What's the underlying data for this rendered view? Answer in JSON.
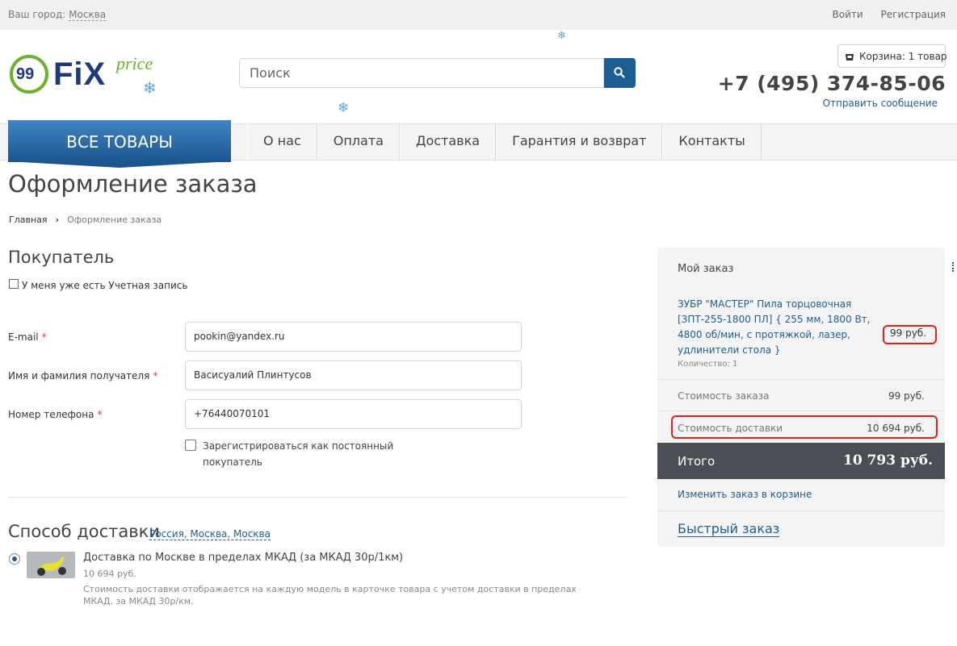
{
  "topbar": {
    "city_label": "Ваш город:",
    "city_value": "Москва",
    "login": "Войти",
    "register": "Регистрация"
  },
  "logo": {
    "badge": "99",
    "brand": "FiX",
    "brand_sub": "price"
  },
  "search": {
    "placeholder": "Поиск"
  },
  "header": {
    "cart": "Корзина: 1 товар",
    "phone": "+7 (495) 374-85-06",
    "send_message": "Отправить сообщение"
  },
  "nav": {
    "all_goods": "ВСЕ ТОВАРЫ",
    "items": [
      "О нас",
      "Оплата",
      "Доставка",
      "Гарантия и возврат",
      "Контакты"
    ]
  },
  "page": {
    "title": "Оформление заказа",
    "breadcrumb": [
      "Главная",
      "Оформление заказа"
    ]
  },
  "buyer": {
    "heading": "Покупатель",
    "have_account": "У меня уже есть Учетная запись",
    "email_label": "E-mail",
    "email_value": "pookin@yandex.ru",
    "name_label": "Имя и фамилия получателя",
    "name_value": "Васисуалий Плинтусов",
    "phone_label": "Номер телефона",
    "phone_value": "+76440070101",
    "register_label": "Зарегистрироваться как постоянный покупатель",
    "required_mark": "*"
  },
  "delivery": {
    "heading": "Способ доставки",
    "location": "Россия, Москва, Москва",
    "option_title": "Доставка по Москве в пределах МКАД (за МКАД 30р/1км)",
    "option_price": "10 694 руб.",
    "option_desc": "Стоимость доставки отображается на каждую модель в карточке товара с учетом доставки в пределах МКАД, за МКАД 30р/км."
  },
  "order": {
    "heading": "Мой заказ",
    "item_name": "ЗУБР \"МАСТЕР\" Пила торцовочная [ЗПТ-255-1800 ПЛ] { 255 мм, 1800 Вт, 4800 об/мин, с протяжкой, лазер, удлинители стола }",
    "item_price": "99 руб.",
    "item_qty": "Количество: 1",
    "order_cost_label": "Стоимость заказа",
    "order_cost_value": "99 руб.",
    "delivery_cost_label": "Стоимость доставки",
    "delivery_cost_value": "10 694 руб.",
    "total_label": "Итого",
    "total_value": "10 793 руб.",
    "edit_link": "Изменить заказ в корзине",
    "quick_order": "Быстрый заказ"
  },
  "colors": {
    "brand_blue": "#1d5d92",
    "brand_green": "#6ab22e",
    "highlight_red": "#e02020",
    "total_bg": "#4b4f55"
  },
  "icons": {
    "snowflake": "❄"
  }
}
